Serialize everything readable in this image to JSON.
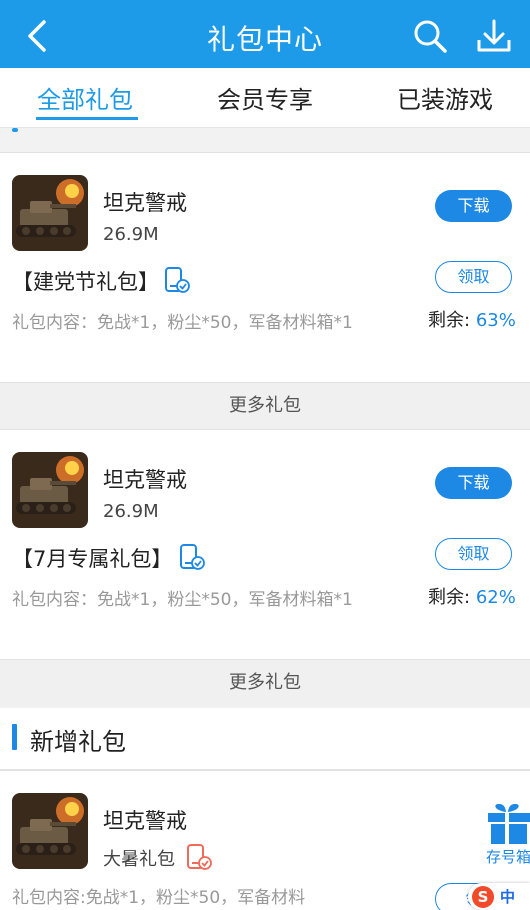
{
  "header": {
    "title": "礼包中心",
    "back_icon": "chevron-left-icon",
    "search_icon": "search-icon",
    "download_icon": "download-icon"
  },
  "tabs": [
    {
      "label": "全部礼包",
      "active": true
    },
    {
      "label": "会员专享",
      "active": false
    },
    {
      "label": "已装游戏",
      "active": false
    }
  ],
  "gifts": [
    {
      "game_name": "坦克警戒",
      "game_size": "26.9M",
      "download_label": "下载",
      "gift_title": "【建党节礼包】",
      "claim_label": "领取",
      "remain_label": "剩余:",
      "remain_percent": "63%",
      "content": "礼包内容：免战*1，粉尘*50，军备材料箱*1",
      "more_label": "更多礼包"
    },
    {
      "game_name": "坦克警戒",
      "game_size": "26.9M",
      "download_label": "下载",
      "gift_title": "【7月专属礼包】",
      "claim_label": "领取",
      "remain_label": "剩余:",
      "remain_percent": "62%",
      "content": "礼包内容：免战*1，粉尘*50，军备材料箱*1",
      "more_label": "更多礼包"
    }
  ],
  "new_section": {
    "title": "新增礼包",
    "game_name": "坦克警戒",
    "gift_name": "大暑礼包",
    "content": "礼包内容:免战*1，粉尘*50，军备材料",
    "claim_label": "领",
    "box_label": "存号箱"
  },
  "ime": {
    "badge": "S",
    "label": "中"
  },
  "colors": {
    "header_bg": "#1e9be8",
    "accent": "#1e88e5",
    "muted_text": "#999999",
    "phone_icon_red": "#f06a5a"
  }
}
